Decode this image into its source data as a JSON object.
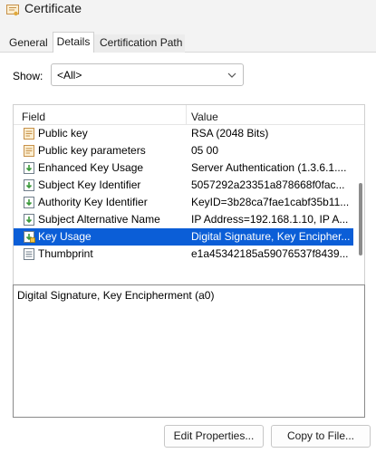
{
  "window": {
    "title": "Certificate"
  },
  "tabs": [
    {
      "label": "General"
    },
    {
      "label": "Details",
      "active": true
    },
    {
      "label": "Certification Path"
    }
  ],
  "show": {
    "label": "Show:",
    "value": "<All>"
  },
  "list": {
    "columns": {
      "field": "Field",
      "value": "Value"
    },
    "rows": [
      {
        "field": "Public key",
        "value": "RSA (2048 Bits)",
        "icon": "certificate-field-icon"
      },
      {
        "field": "Public key parameters",
        "value": "05 00",
        "icon": "certificate-field-icon"
      },
      {
        "field": "Enhanced Key Usage",
        "value": "Server Authentication (1.3.6.1....",
        "icon": "extension-icon"
      },
      {
        "field": "Subject Key Identifier",
        "value": "5057292a23351a878668f0fac...",
        "icon": "extension-icon"
      },
      {
        "field": "Authority Key Identifier",
        "value": "KeyID=3b28ca7fae1cabf35b11...",
        "icon": "extension-icon"
      },
      {
        "field": "Subject Alternative Name",
        "value": "IP Address=192.168.1.10, IP A...",
        "icon": "extension-icon"
      },
      {
        "field": "Key Usage",
        "value": "Digital Signature, Key Encipher...",
        "icon": "critical-extension-icon",
        "selected": true
      },
      {
        "field": "Thumbprint",
        "value": "e1a45342185a59076537f8439...",
        "icon": "thumbprint-icon"
      }
    ]
  },
  "detail": {
    "text": "Digital Signature, Key Encipherment (a0)"
  },
  "buttons": {
    "edit_properties": "Edit Properties...",
    "copy_to_file": "Copy to File..."
  },
  "colors": {
    "selection": "#0b5ed7",
    "window_bg": "#f3f3f3"
  }
}
